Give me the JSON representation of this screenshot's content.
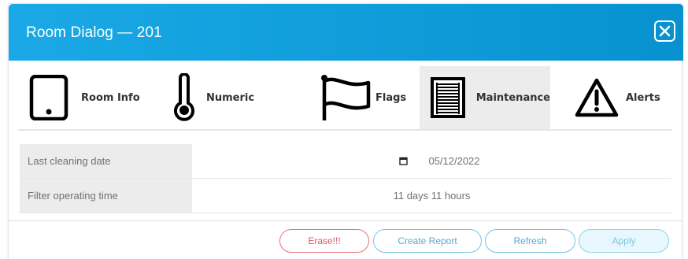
{
  "dialog": {
    "title": "Room Dialog — 201",
    "close_icon": "close-x-icon"
  },
  "tabs": [
    {
      "label": "Room Info",
      "icon": "tablet-icon"
    },
    {
      "label": "Numeric",
      "icon": "thermometer-icon"
    },
    {
      "label": "Flags",
      "icon": "flag-icon"
    },
    {
      "label": "Maintenance",
      "icon": "air-filter-icon",
      "active": true
    },
    {
      "label": "Alerts",
      "icon": "warning-triangle-icon"
    }
  ],
  "maintenance": {
    "rows": [
      {
        "label": "Last cleaning date",
        "value": "05/12/2022",
        "icon": "calendar-icon"
      },
      {
        "label": "Filter operating time",
        "value": "11 days 11 hours"
      }
    ]
  },
  "buttons": {
    "erase": "Erase!!!",
    "create_report": "Create Report",
    "refresh": "Refresh",
    "apply": "Apply"
  },
  "colors": {
    "title_bar": "#0a96d4",
    "erase": "#e25561",
    "action": "#5aa7cf",
    "active_tab": "#ececec"
  }
}
